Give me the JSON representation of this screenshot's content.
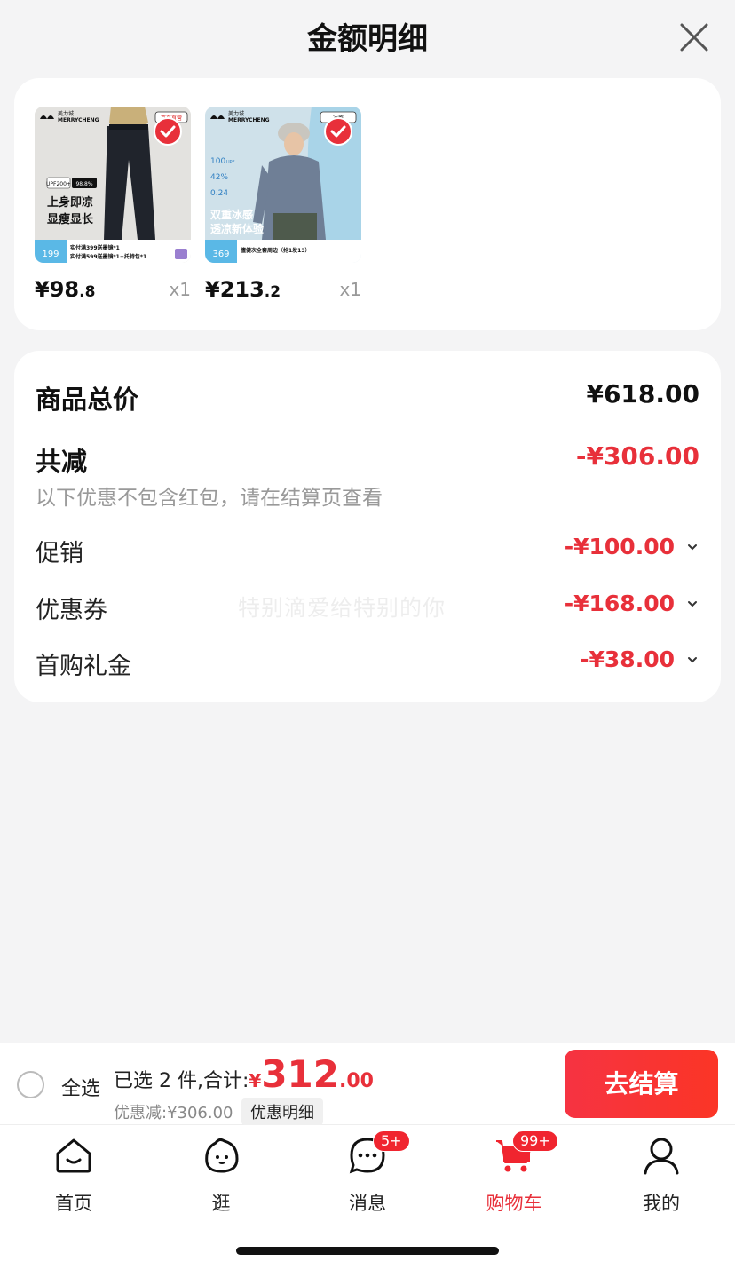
{
  "header": {
    "title": "金额明细"
  },
  "products": [
    {
      "price_int": "¥98",
      "price_dec": ".8",
      "qty": "x1",
      "brand_cn": "美力城",
      "brand_en": "MERRYCHENG",
      "tag": "京东直营",
      "badge1": "UPF200+",
      "badge2": "98.8%",
      "slogan1": "上身即凉",
      "slogan2": "显瘦显长",
      "promo_price": "199",
      "promo_line1": "实付满399送墨镜*1",
      "promo_line2": "实付满599送墨镜*1+托特包*1"
    },
    {
      "price_int": "¥213",
      "price_dec": ".2",
      "qty": "x1",
      "brand_cn": "美力城",
      "brand_en": "MERRYCHENG",
      "tag": "冰感",
      "stat1": "100",
      "stat1_unit": "UPF",
      "stat2": "42%",
      "stat3": "0.24",
      "slogan1": "双重冰感",
      "slogan2": "透凉新体验",
      "promo_price": "369",
      "promo_line1": "檀健次全套周边（抢1发13）"
    }
  ],
  "summary": {
    "total_label": "商品总价",
    "total_value": "¥618.00",
    "reduce_label": "共减",
    "reduce_value": "-¥306.00",
    "note": "以下优惠不包含红包，请在结算页查看",
    "items": [
      {
        "label": "促销",
        "value": "-¥100.00"
      },
      {
        "label": "优惠券",
        "value": "-¥168.00"
      },
      {
        "label": "首购礼金",
        "value": "-¥38.00"
      }
    ],
    "watermark": "特别滴爱给特别的你"
  },
  "bottom": {
    "select_all": "全选",
    "selected_prefix": "已选 2 件,合计:",
    "currency": "¥",
    "total_int": "312",
    "total_dec": ".00",
    "discount_text": "优惠减:¥306.00",
    "discount_detail": "优惠明细",
    "checkout": "去结算"
  },
  "tabs": [
    {
      "label": "首页",
      "icon": "home-icon"
    },
    {
      "label": "逛",
      "icon": "explore-face-icon"
    },
    {
      "label": "消息",
      "icon": "message-icon",
      "badge": "5+"
    },
    {
      "label": "购物车",
      "icon": "cart-icon",
      "badge": "99+",
      "active": true
    },
    {
      "label": "我的",
      "icon": "profile-icon"
    }
  ],
  "colors": {
    "accent": "#e8303a",
    "background": "#f4f4f5"
  }
}
